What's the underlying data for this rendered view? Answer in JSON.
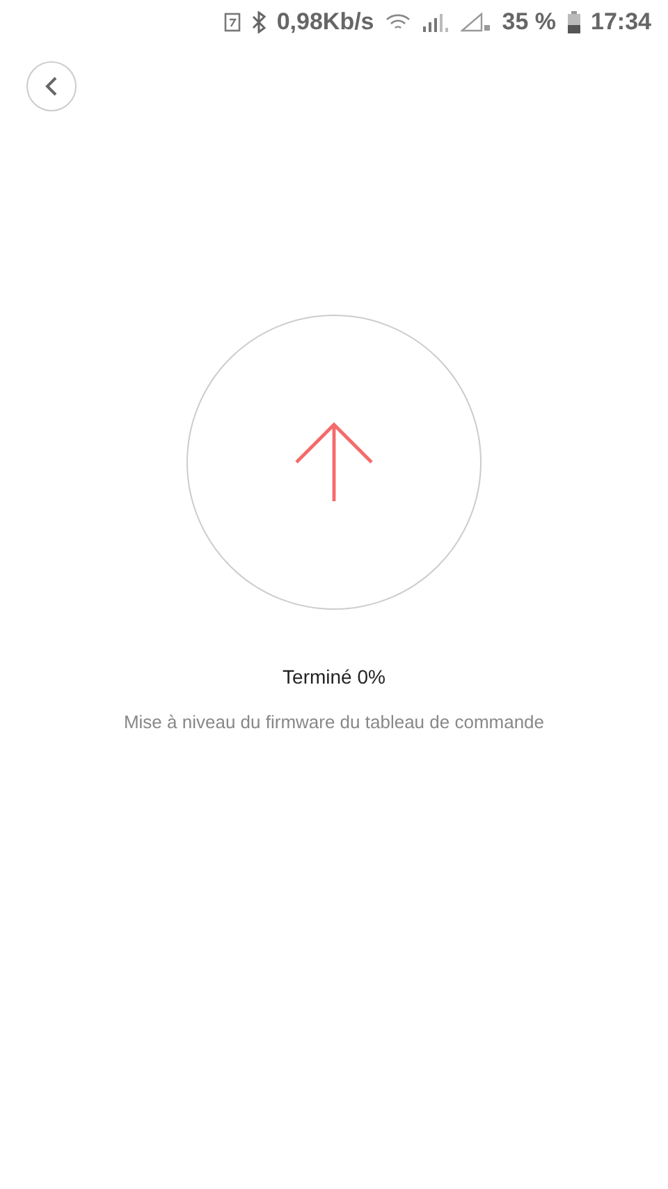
{
  "status_bar": {
    "speed": "0,98Kb/s",
    "battery_percent": "35 %",
    "time": "17:34"
  },
  "progress": {
    "status": "Terminé 0%",
    "description": "Mise à niveau du firmware du tableau de commande"
  }
}
